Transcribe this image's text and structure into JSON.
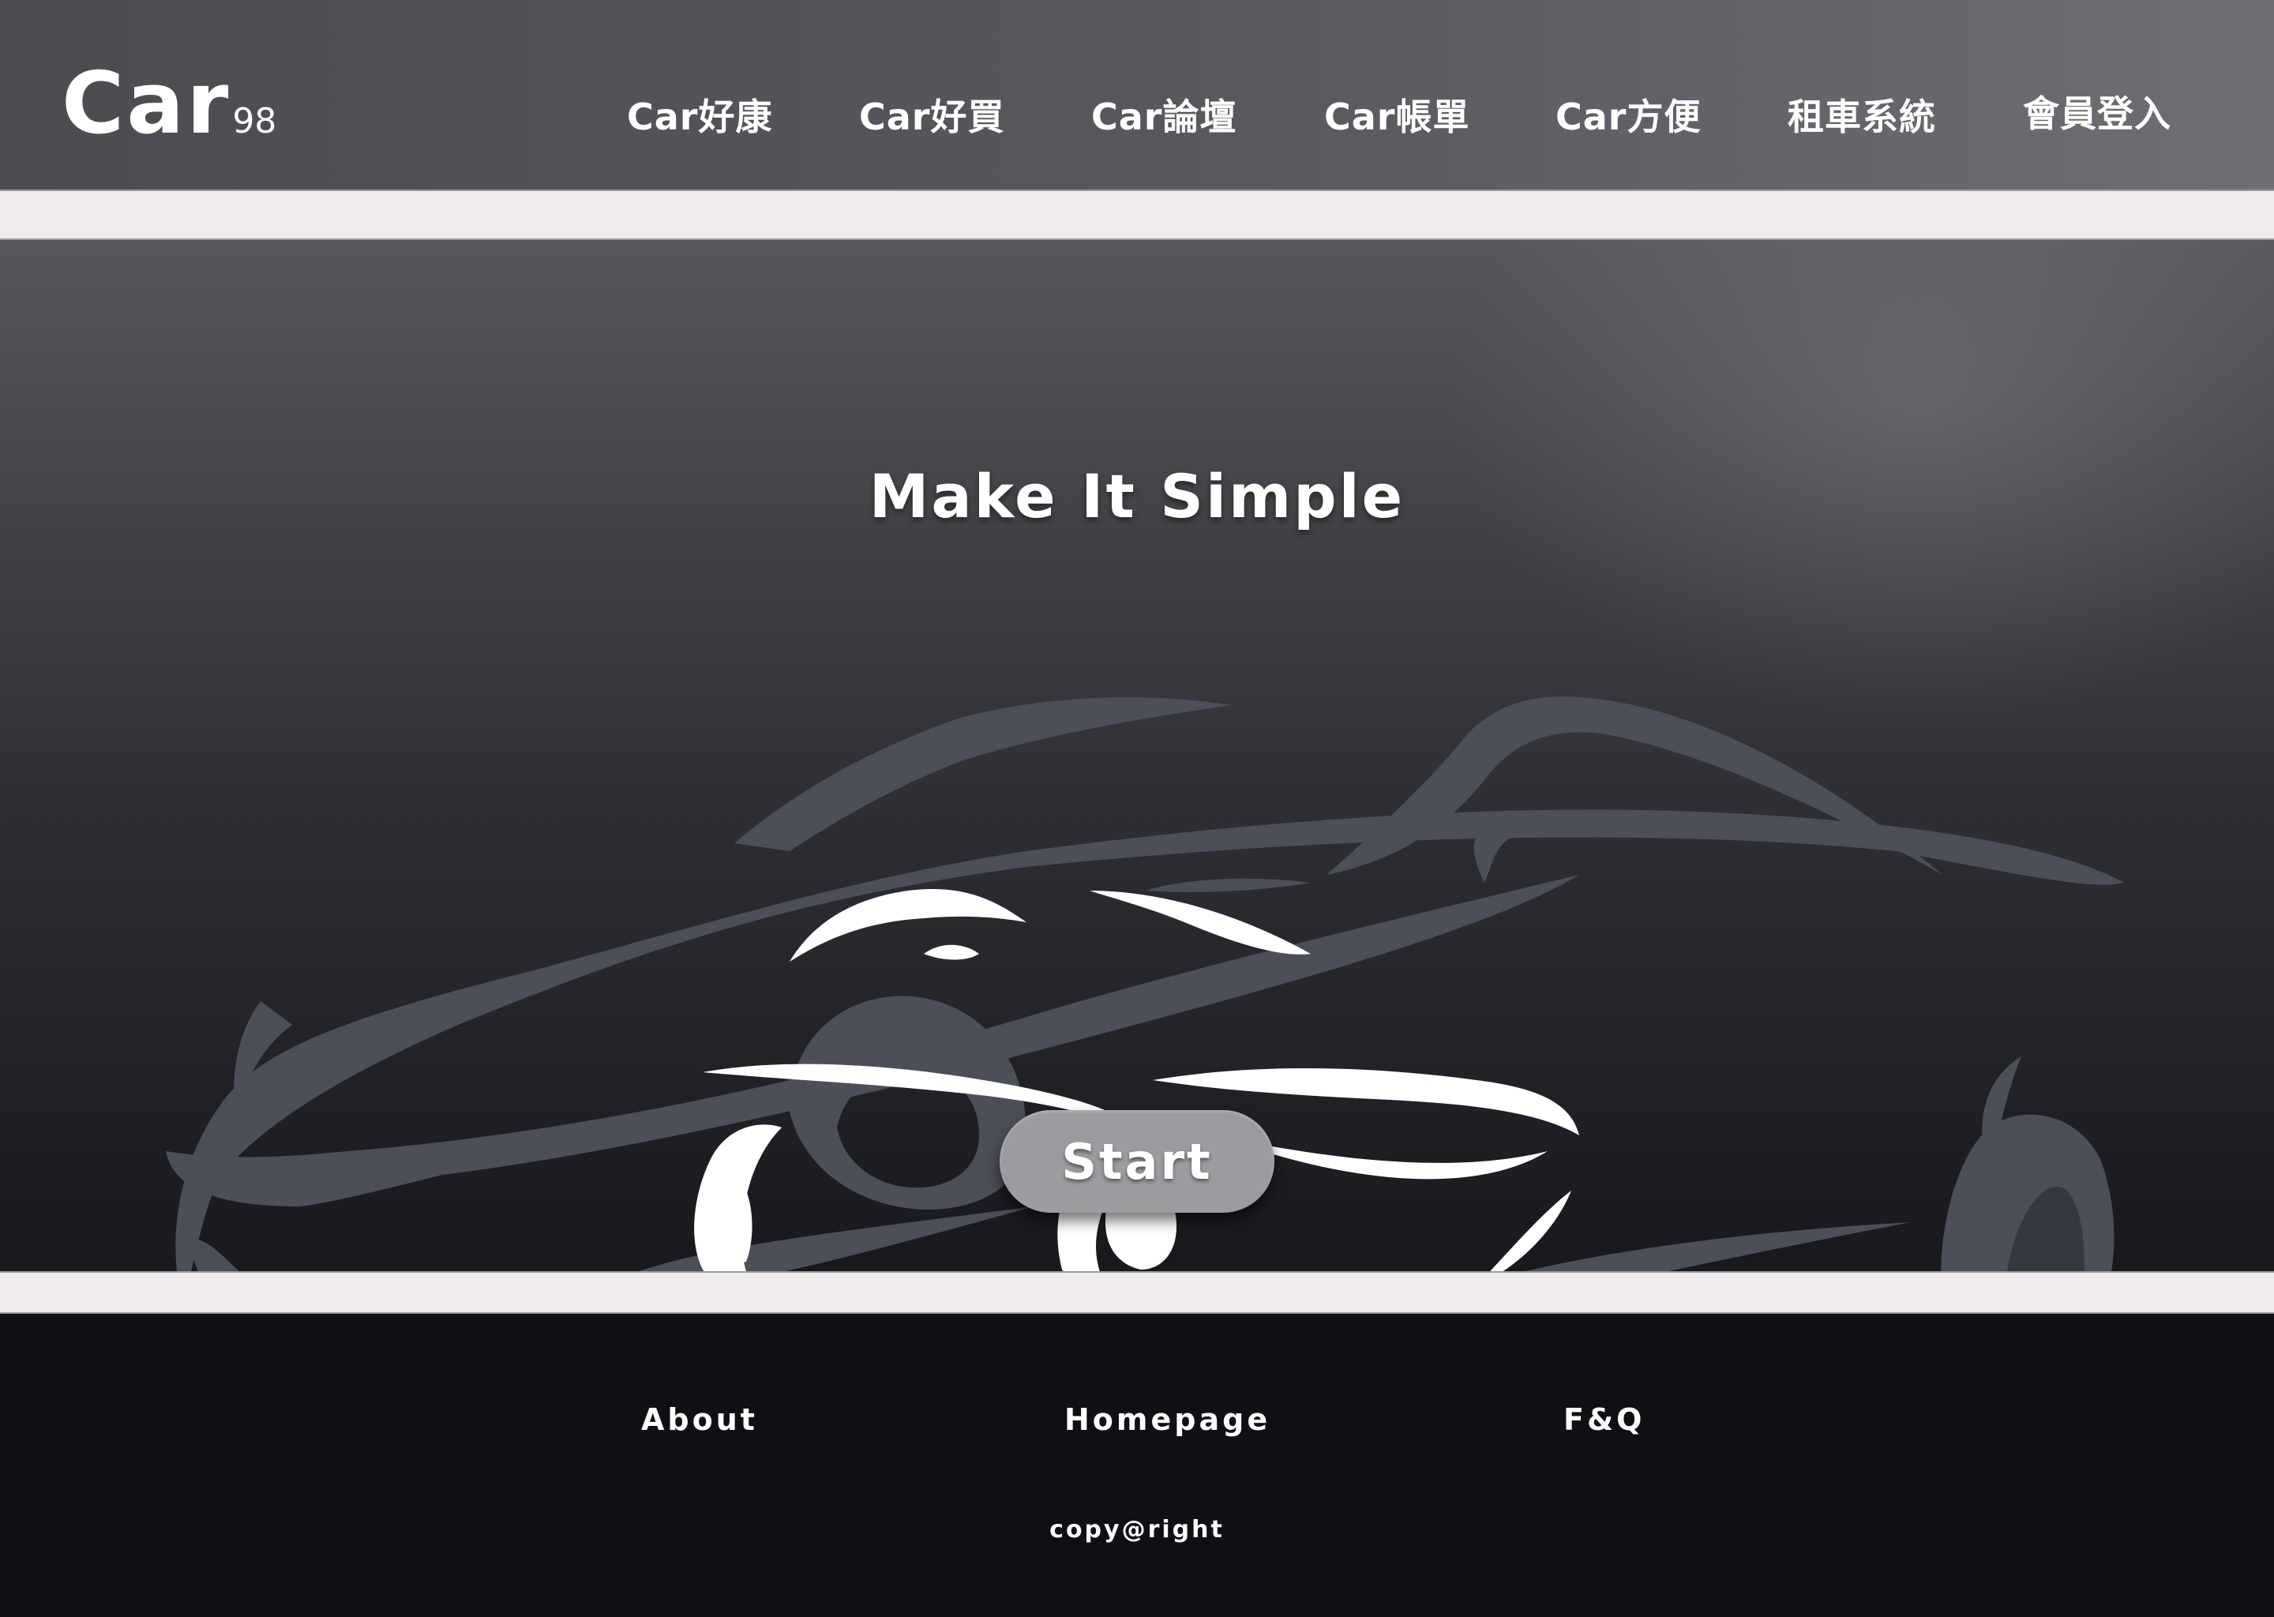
{
  "header": {
    "logo_main": "Car",
    "logo_sub": "98",
    "nav": [
      {
        "label": "Car好康"
      },
      {
        "label": "Car好買"
      },
      {
        "label": "Car論壇"
      },
      {
        "label": "Car帳單"
      },
      {
        "label": "Car方便"
      },
      {
        "label": "租車系統"
      },
      {
        "label": "會員登入"
      }
    ]
  },
  "hero": {
    "title": "Make It Simple",
    "start_label": "Start"
  },
  "footer": {
    "links": [
      {
        "label": "About"
      },
      {
        "label": "Homepage"
      },
      {
        "label": "F&Q"
      }
    ],
    "copyright": "copy@right"
  },
  "colors": {
    "header_bg": "#58595e",
    "band": "#f0ecec",
    "footer_bg": "#0e1015",
    "button": "#9c9ca0",
    "car_silhouette": "#4b4f57",
    "text": "#ffffff"
  },
  "icons": [
    "car-silhouette-icon",
    "car-logo-icon"
  ]
}
